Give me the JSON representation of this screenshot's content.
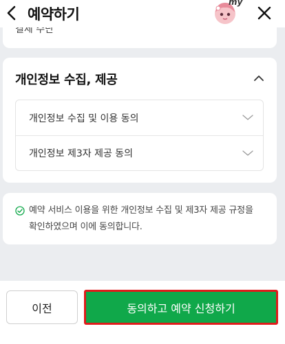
{
  "header": {
    "title": "예약하기",
    "back_icon": "chevron-left-icon",
    "close_icon": "close-icon",
    "avatar_badge": "my"
  },
  "top_card": {
    "partial_text": "결제 수단"
  },
  "privacy": {
    "title": "개인정보 수집, 제공",
    "toggle_icon": "chevron-up-icon",
    "items": [
      {
        "label": "개인정보 수집 및 이용 동의",
        "icon": "chevron-down-icon"
      },
      {
        "label": "개인정보 제3자 제공 동의",
        "icon": "chevron-down-icon"
      }
    ]
  },
  "agreement": {
    "icon": "check-circle-icon",
    "text": "예약 서비스 이용을 위한 개인정보 수집 및 제3자 제공 규정을 확인하였으며 이에 동의합니다."
  },
  "bottom": {
    "prev_label": "이전",
    "submit_label": "동의하고 예약 신청하기"
  },
  "colors": {
    "accent_green": "#10a84a",
    "highlight_red": "#e01b1b",
    "background": "#ebedf0"
  }
}
